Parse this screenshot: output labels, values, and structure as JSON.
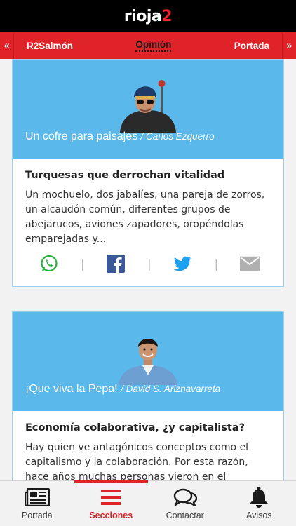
{
  "app": {
    "logo_main": "rioja",
    "logo_accent": "2"
  },
  "sections": {
    "prev": "R2Salmón",
    "current": "Opinión",
    "next": "Portada"
  },
  "cards": [
    {
      "blog": "Un cofre para paisajes",
      "author": "/ Carlos Ezquerro",
      "title": "Turquesas que derrochan vitalidad",
      "excerpt": "Un mochuelo, dos jabalíes, una pareja de zorros, un alcaudón común, diferentes grupos de abejarucos, aviones zapadores, oropéndolas emparejadas y..."
    },
    {
      "blog": "¡Que viva la Pepa!",
      "author": "/ David S. Ariznavarreta",
      "title": "Economía colaborativa, ¿y capitalista?",
      "excerpt": "Hay quien ve antagónicos conceptos como el capitalismo y la colaboración. Por esta razón, hace años muchas personas vieron en el surgimiento de"
    }
  ],
  "share": {
    "separator": "|",
    "icons": [
      "whatsapp-icon",
      "facebook-icon",
      "twitter-icon",
      "email-icon"
    ]
  },
  "tabs": [
    {
      "label": "Portada",
      "icon": "newspaper-icon"
    },
    {
      "label": "Secciones",
      "icon": "menu-icon"
    },
    {
      "label": "Contactar",
      "icon": "chat-icon"
    },
    {
      "label": "Avisos",
      "icon": "bell-icon"
    }
  ],
  "colors": {
    "brand_red": "#e02329",
    "card_blue": "#5ab8ea",
    "whatsapp": "#25b43c",
    "facebook": "#3b5998",
    "twitter": "#1da1f2",
    "email": "#b0b0b0"
  }
}
